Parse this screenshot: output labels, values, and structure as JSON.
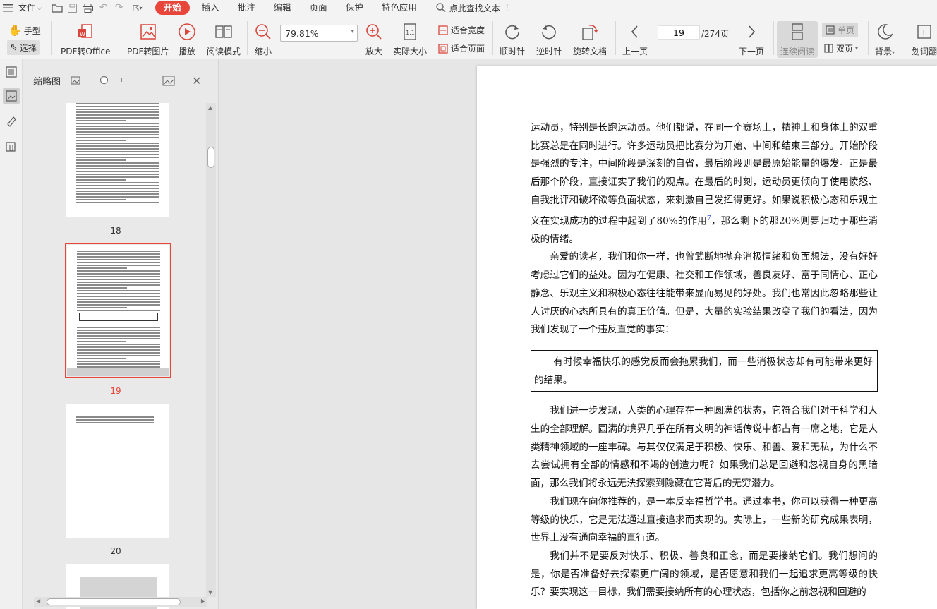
{
  "menubar": {
    "file_label": "文件",
    "tabs": [
      "开始",
      "插入",
      "批注",
      "编辑",
      "页面",
      "保护",
      "特色应用"
    ],
    "search_label": "点此查找文本"
  },
  "ribbon": {
    "hand_label": "手型",
    "select_label": "选择",
    "pdf_to_office": "PDF转Office",
    "pdf_to_image": "PDF转图片",
    "play": "播放",
    "read_mode": "阅读模式",
    "zoom_out": "缩小",
    "zoom_value": "79.81%",
    "zoom_in": "放大",
    "actual_size": "实际大小",
    "fit_width": "适合宽度",
    "fit_page": "适合页面",
    "clockwise": "顺时针",
    "counterclockwise": "逆时针",
    "rotate_doc": "旋转文档",
    "prev_page": "上一页",
    "page_current": "19",
    "page_total": "/274页",
    "next_page": "下一页",
    "continuous_read": "连续阅读",
    "single_page": "单页",
    "double_page": "双页",
    "background": "背景",
    "translate": "划词翻"
  },
  "thumbnail_panel": {
    "title": "缩略图",
    "pages": [
      "18",
      "19",
      "20"
    ],
    "active_page": "19"
  },
  "document": {
    "paragraphs": [
      "运动员，特别是长跑运动员。他们都说，在同一个赛场上，精神上和身体上的双重比赛总是在同时进行。许多运动员把比赛分为开始、中间和结束三部分。开始阶段是强烈的专注，中间阶段是深刻的自省，最后阶段则是最原始能量的爆发。正是最后那个阶段，直接证实了我们的观点。在最后的时刻，运动员更倾向于使用愤怒、自我批评和破坏欲等负面状态，来刺激自己发挥得更好。如果说积极心态和乐观主义在实现成功的过程中起到了80%的作用",
      "，那么剩下的那20%则要归功于那些消极的情绪。",
      "亲爱的读者，我们和你一样，也曾武断地抛弃消极情绪和负面想法，没有好好考虑过它们的益处。因为在健康、社交和工作领域，善良友好、富于同情心、正心静念、乐观主义和积极心态往往能带来显而易见的好处。我们也常因此忽略那些让人讨厌的心态所具有的真正价值。但是，大量的实验结果改变了我们的看法，因为我们发现了一个违反直觉的事实：",
      "我们进一步发现，人类的心理存在一种圆满的状态，它符合我们对于科学和人生的全部理解。圆满的境界几乎在所有文明的神话传说中都占有一席之地，它是人类精神领域的一座丰碑。与其仅仅满足于积极、快乐、和善、爱和无私，为什么不去尝试拥有全部的情感和不竭的创造力呢？如果我们总是回避和忽视自身的黑暗面，那么我们将永远无法探索到隐藏在它背后的无穷潜力。",
      "我们现在向你推荐的，是一本反幸福哲学书。通过本书，你可以获得一种更高等级的快乐，它是无法通过直接追求而实现的。实际上，一些新的研究成果表明，世界上没有通向幸福的直行道。",
      "我们并不是要反对快乐、积极、善良和正念，而是要接纳它们。我们想问的是，你是否准备好去探索更广阔的领域，是否愿意和我们一起追求更高等级的快乐？要实现这一目标，我们需要接纳所有的心理状态，包括你之前忽视和回避的"
    ],
    "footnote_ref": "7",
    "boxed_quote": "有时候幸福快乐的感觉反而会拖累我们，而一些消极状态却有可能带来更好的结果。"
  }
}
